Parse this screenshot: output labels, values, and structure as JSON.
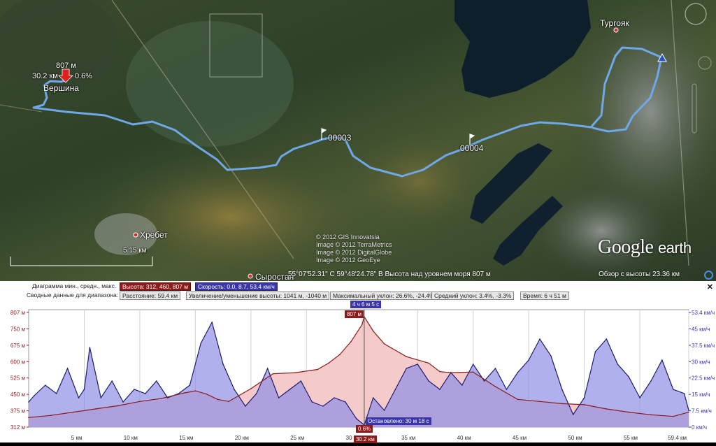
{
  "map": {
    "places": {
      "turgoyak": "Тургояк",
      "khrebet": "Хребет",
      "syrostan": "Сыростан",
      "vershina": "Вершина"
    },
    "peak_marker": {
      "elev": "807 м",
      "dist": "30.2 км",
      "grade": "0.6%"
    },
    "waypoints": [
      "00003",
      "00004"
    ],
    "scale_label": "5.15 км",
    "copyright": [
      "© 2012 GIS Innovatsia",
      "Image © 2012 TerraMetrics",
      "Image © 2012 DigitalGlobe",
      "Image © 2012 GeoEye"
    ],
    "logo": {
      "google": "Google",
      "earth": "earth"
    },
    "status": {
      "coords": "55°07'52.31\" С   59°48'24.78\" В  Высота над уровнем моря   807 м",
      "overview": "Обзор с высоты   23.36 км"
    },
    "colors": {
      "track": "#6fa8e8",
      "lake": "#0e1f2c",
      "forest": "#3d4a2a"
    }
  },
  "panel": {
    "row1": {
      "label": "Диаграмма мин., средн., макс.",
      "elev_chip": "Высота: 312, 460, 807 м",
      "speed_chip": "Скорость: 0.0, 8.7, 53.4 км/ч"
    },
    "row2": {
      "label": "Сводные данные для диапазона:",
      "distance": "Расстояние: 59.4 км",
      "gain": "Увеличение/уменьшение высоты: 1041 м, -1040 м",
      "max_grade": "Максимальный уклон: 26.6%, -24.4%",
      "avg_grade": "Средний уклон: 3.4%, -3.3%",
      "time": "Время: 6 ч 51 м"
    },
    "close": "✕"
  },
  "chart_data": {
    "type": "area",
    "x_unit": "км",
    "xlim": [
      0,
      59.4
    ],
    "ylim_elev": [
      290,
      840
    ],
    "ylim_speed": [
      0,
      56
    ],
    "y_ticks_left": [
      "807 м",
      "750 м",
      "675 м",
      "600 м",
      "525 м",
      "450 м",
      "375 м",
      "312 м"
    ],
    "y_ticks_right": [
      "53.4 км/ч",
      "45 км/ч",
      "37.5 км/ч",
      "30 км/ч",
      "22.5 км/ч",
      "15 км/ч",
      "7.5 км/ч",
      "0 км/ч"
    ],
    "x_ticks": [
      "5 км",
      "10 км",
      "15 км",
      "20 км",
      "25 км",
      "30 км",
      "35 км",
      "40 км",
      "45 км",
      "50 км",
      "55 км",
      "59.4 км"
    ],
    "x_tick_values": [
      5,
      10,
      15,
      20,
      25,
      30,
      35,
      40,
      45,
      50,
      55,
      59.4
    ],
    "series": [
      {
        "name": "Высота",
        "color": "#8b1a1a",
        "fill": "#f4c4c4",
        "x": [
          0,
          2,
          4,
          6,
          8,
          10,
          12,
          14,
          15,
          16,
          17,
          18,
          20,
          22,
          24,
          26,
          27,
          28,
          29,
          30,
          30.2,
          31,
          32,
          34,
          36,
          37,
          38,
          40,
          42,
          44,
          46,
          48,
          50,
          52,
          54,
          56,
          58,
          59.4
        ],
        "y": [
          335,
          345,
          360,
          375,
          390,
          410,
          425,
          450,
          460,
          445,
          420,
          410,
          470,
          540,
          545,
          560,
          590,
          630,
          690,
          770,
          807,
          740,
          680,
          620,
          590,
          550,
          545,
          548,
          480,
          420,
          410,
          400,
          395,
          375,
          360,
          348,
          340,
          360
        ]
      },
      {
        "name": "Скорость",
        "color": "#1e1a70",
        "fill": "#8f8ee6",
        "x": [
          0,
          0.5,
          1.5,
          2.5,
          3.5,
          4.5,
          5,
          5.5,
          6.5,
          7.5,
          8.5,
          9.5,
          10.5,
          11.5,
          12.5,
          13.5,
          14.5,
          15.5,
          16.5,
          17.5,
          18.5,
          19.5,
          20.5,
          21.5,
          22.5,
          23.5,
          24.5,
          25.5,
          26.5,
          27.5,
          28.5,
          29.5,
          30.2,
          31,
          32,
          33,
          34,
          35,
          36,
          37,
          38,
          39,
          40,
          41,
          42,
          43,
          44,
          45,
          46,
          47,
          48,
          49,
          50,
          51,
          52,
          53,
          54,
          55,
          56,
          57,
          58,
          59,
          59.4
        ],
        "y": [
          12,
          15,
          20,
          16,
          28,
          14,
          18,
          38,
          14,
          22,
          12,
          18,
          16,
          22,
          14,
          16,
          20,
          40,
          50,
          30,
          18,
          10,
          16,
          28,
          14,
          18,
          22,
          12,
          10,
          14,
          12,
          4,
          1,
          14,
          8,
          18,
          28,
          30,
          22,
          18,
          26,
          20,
          30,
          22,
          28,
          18,
          26,
          32,
          42,
          34,
          18,
          6,
          14,
          36,
          42,
          30,
          24,
          14,
          22,
          32,
          18,
          16,
          8
        ]
      }
    ],
    "annotations": {
      "time_top": "4 ч 6 м 5 с",
      "elev_top": "807 м",
      "grade_bottom": "0.6%",
      "stopped": "Остановлено: 30 м 18 с",
      "x_cursor_label": "30.2 км",
      "cursor_x": 30.2
    }
  }
}
